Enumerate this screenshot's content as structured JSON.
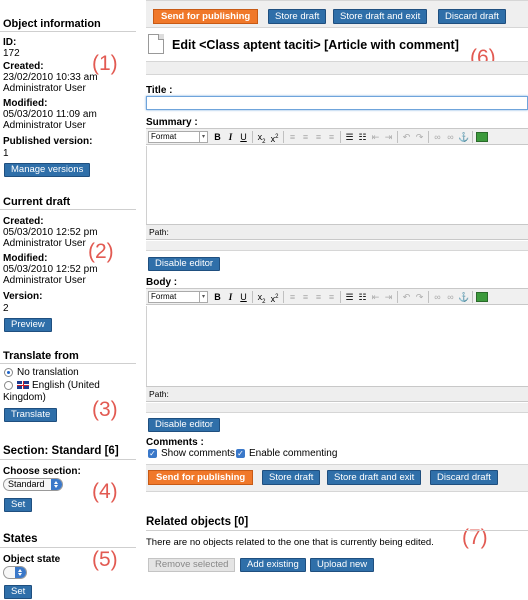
{
  "sidebar": {
    "object_info": {
      "title": "Object information",
      "id_label": "ID:",
      "id_value": "172",
      "created_label": "Created:",
      "created_value": "23/02/2010 10:33 am",
      "created_by": "Administrator User",
      "modified_label": "Modified:",
      "modified_value": "05/03/2010 11:09 am",
      "modified_by": "Administrator User",
      "published_label": "Published version:",
      "published_value": "1",
      "manage_button": "Manage versions"
    },
    "current_draft": {
      "title": "Current draft",
      "created_label": "Created:",
      "created_value": "05/03/2010 12:52 pm",
      "created_by": "Administrator User",
      "modified_label": "Modified:",
      "modified_value": "05/03/2010 12:52 pm",
      "modified_by": "Administrator User",
      "version_label": "Version:",
      "version_value": "2",
      "preview_button": "Preview"
    },
    "translate": {
      "title": "Translate from",
      "option_none": "No translation",
      "option_english_line1": "English (United",
      "option_english_line2": "Kingdom)",
      "button": "Translate"
    },
    "section": {
      "title": "Section: Standard [6]",
      "choose_label": "Choose section:",
      "selected": "Standard",
      "set_button": "Set"
    },
    "states": {
      "title": "States",
      "object_state_label": "Object state",
      "selected": "",
      "set_button": "Set"
    }
  },
  "main": {
    "top_buttons": {
      "send": "Send for publishing",
      "store": "Store draft",
      "store_exit": "Store draft and exit",
      "discard": "Discard draft"
    },
    "heading": "Edit <Class aptent taciti> [Article with comment]",
    "title_label": "Title :",
    "title_value": "",
    "summary_label": "Summary :",
    "body_label": "Body :",
    "format_select": "Format",
    "path_label": "Path:",
    "disable_editor": "Disable editor",
    "comments_label": "Comments :",
    "show_comments": "Show comments",
    "enable_commenting": "Enable commenting",
    "bottom_buttons": {
      "send": "Send for publishing",
      "store": "Store draft",
      "store_exit": "Store draft and exit",
      "discard": "Discard draft"
    },
    "related_title": "Related objects [0]",
    "related_text": "There are no objects related to the one that is currently being edited.",
    "remove_selected": "Remove selected",
    "add_existing": "Add existing",
    "upload_new": "Upload new"
  },
  "annotations": {
    "a1": "(1)",
    "a2": "(2)",
    "a3": "(3)",
    "a4": "(4)",
    "a5": "(5)",
    "a6": "(6)",
    "a7": "(7)"
  },
  "colors": {
    "primary_button": "#2f6fa9",
    "publish_button": "#f0782a",
    "annotation": "#e25a52"
  }
}
